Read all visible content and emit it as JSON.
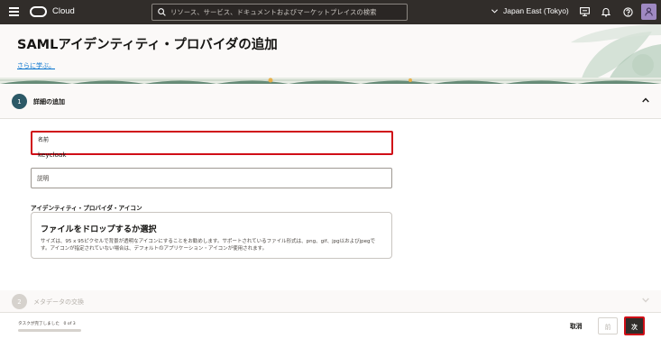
{
  "topbar": {
    "brand": "Cloud",
    "search_placeholder": "リソース、サービス、ドキュメントおよびマーケットプレイスの検索",
    "region": "Japan East (Tokyo)",
    "icons": [
      "menu-icon",
      "oracle-logo-icon",
      "search-icon",
      "chevron-down-icon",
      "console-icon",
      "bell-icon",
      "help-icon",
      "user-icon"
    ]
  },
  "header": {
    "title": "SAMLアイデンティティ・プロバイダの追加",
    "learn_more": "さらに学ぶ。"
  },
  "steps": [
    {
      "number": "1",
      "label": "詳細の追加"
    },
    {
      "number": "2",
      "label": "メタデータの交換"
    }
  ],
  "form": {
    "name_label": "名前",
    "name_value": "keycloak",
    "description_placeholder": "説明",
    "icon_label": "アイデンティティ・プロバイダ・アイコン",
    "dropzone_title": "ファイルをドロップするか選択",
    "dropzone_desc": "サイズは、95 x 95ピクセルで背景が透明なアイコンにすることをお勧めします。サポートされているファイル形式は、png、gif、jpg以およびjpegです。アイコンが指定されていない場合は、デフォルトのアプリケーション・アイコンが使用されます。"
  },
  "footer": {
    "progress_label": "タスクが完了しました　0 of 3",
    "progress_fraction": 0,
    "cancel": "取消",
    "previous": "前",
    "next": "次"
  },
  "colors": {
    "topbar_bg": "#312d2a",
    "accent": "#2c5967",
    "highlight": "#d00e17",
    "link": "#0572ce"
  }
}
